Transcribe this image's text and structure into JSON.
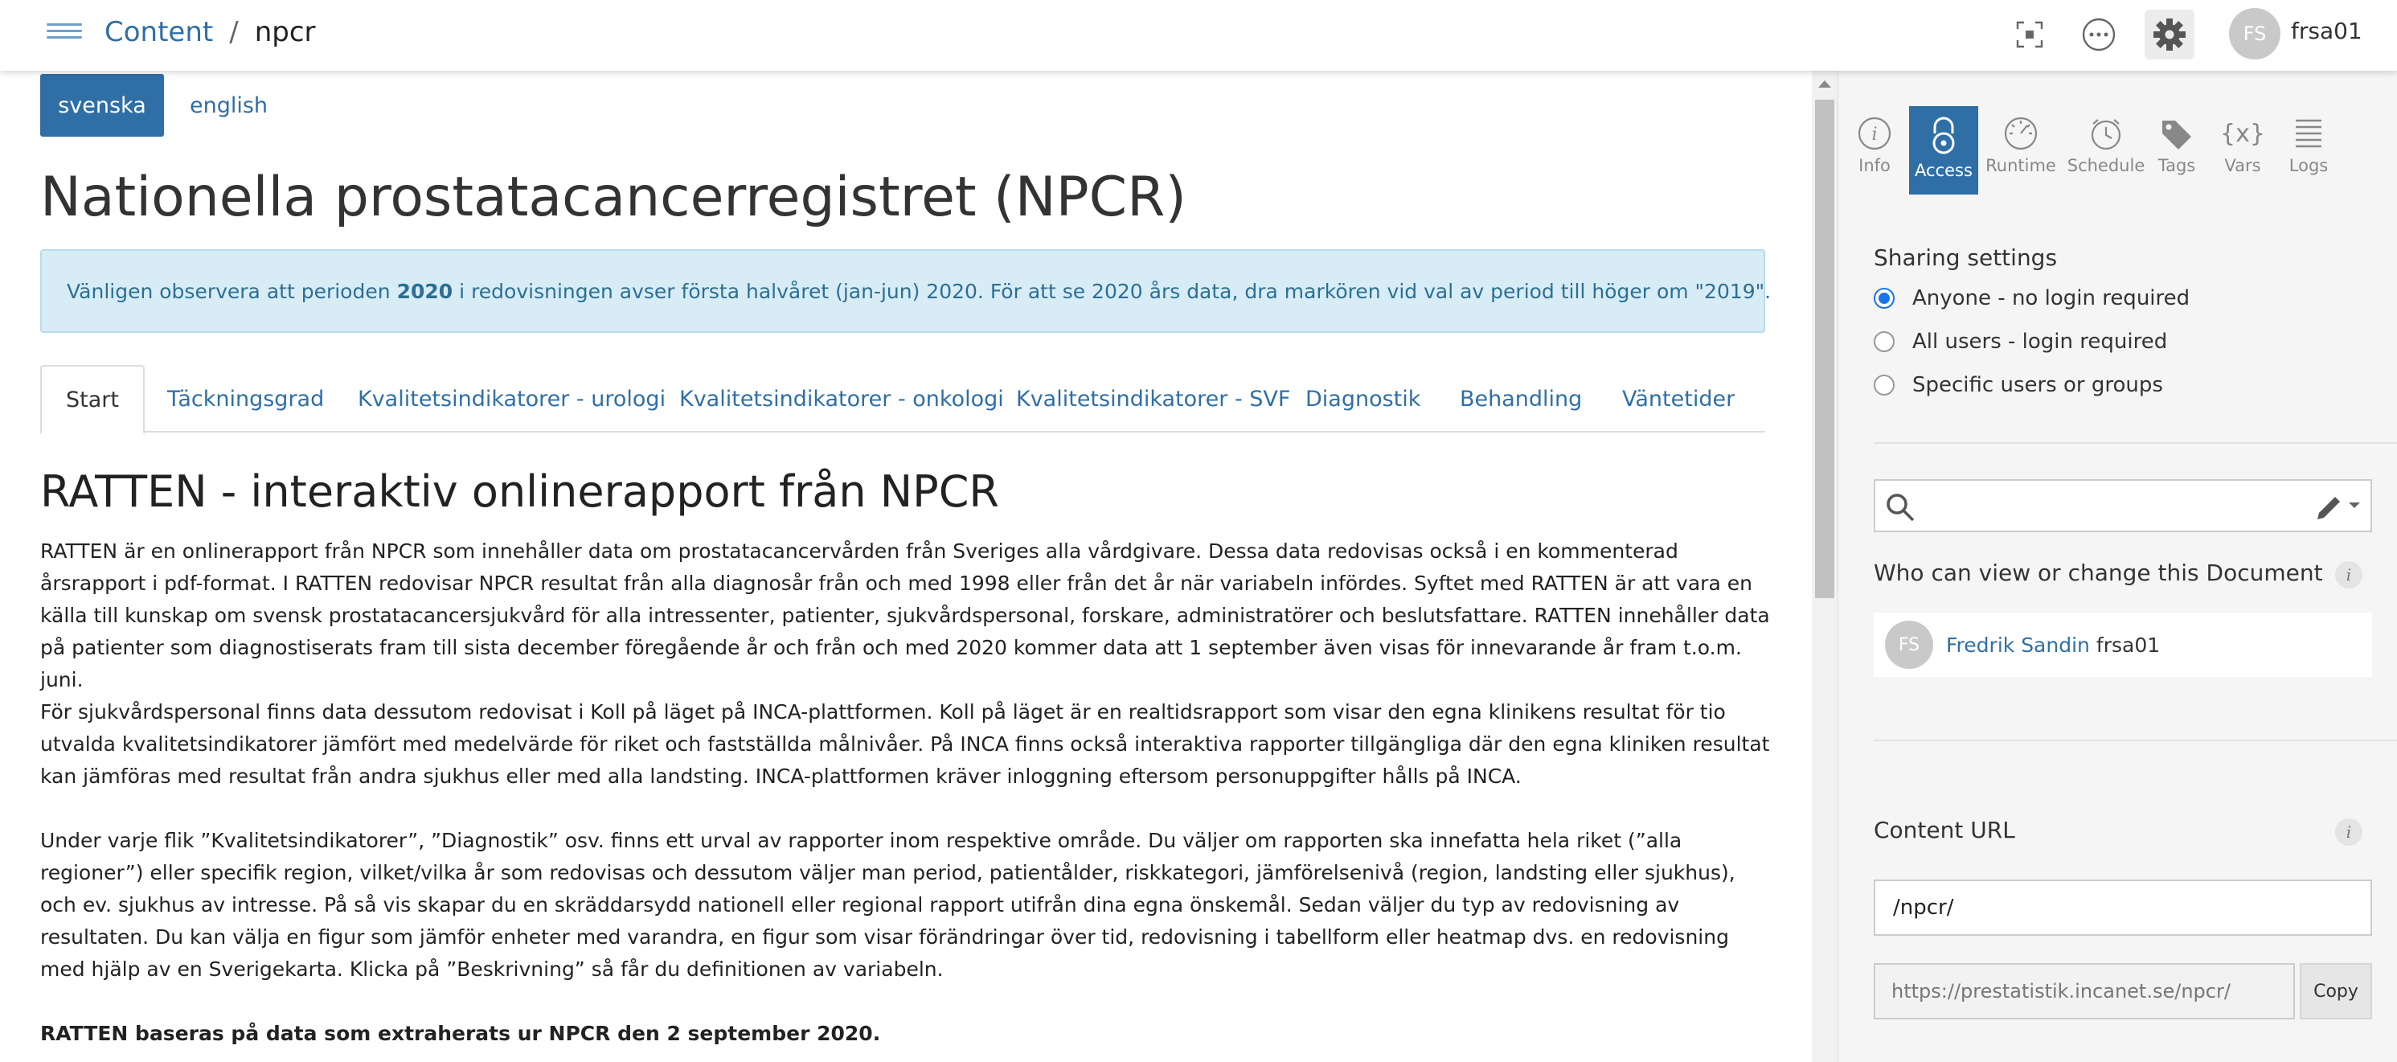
{
  "header": {
    "breadcrumb_root": "Content",
    "breadcrumb_sep": "/",
    "breadcrumb_current": "npcr",
    "avatar_initials": "FS",
    "username": "frsa01",
    "icons": [
      "menu-icon",
      "fullscreen-icon",
      "more-icon",
      "gear-icon"
    ]
  },
  "main": {
    "lang_active": "svenska",
    "lang_other": "english",
    "title": "Nationella prostatacancerregistret (NPCR)",
    "notice": {
      "before": "Vänligen observera att perioden",
      "bold": "2020",
      "after": "i redovisningen avser första halvåret (jan-jun) 2020. För att se 2020 års data, dra markören vid val av period till höger om \"2019\"."
    },
    "tabs": [
      {
        "label": "Start"
      },
      {
        "label": "Täckningsgrad"
      },
      {
        "label": "Kvalitetsindikatorer - urologi"
      },
      {
        "label": "Kvalitetsindikatorer - onkologi"
      },
      {
        "label": "Kvalitetsindikatorer - SVF"
      },
      {
        "label": "Diagnostik"
      },
      {
        "label": "Behandling"
      },
      {
        "label": "Väntetider"
      }
    ],
    "section_title": "RATTEN - interaktiv onlinerapport från NPCR",
    "paragraphs": [
      "RATTEN är en onlinerapport från NPCR som innehåller data om prostatacancervården från Sveriges alla vårdgivare. Dessa data redovisas också i en kommenterad årsrapport i pdf-format. I RATTEN redovisar NPCR resultat från alla diagnosår från och med 1998 eller från det år när variabeln infördes. Syftet med RATTEN är att vara en källa till kunskap om svensk prostatacancersjukvård för alla intressenter, patienter, sjukvårdspersonal, forskare, administratörer och beslutsfattare. RATTEN innehåller data på patienter som diagnostiserats fram till sista december föregående år och från och med 2020 kommer data att 1 september även visas för innevarande år fram t.o.m. juni.",
      "För sjukvårdspersonal finns data dessutom redovisat i Koll på läget på INCA-plattformen. Koll på läget är en realtidsrapport som visar den egna klinikens resultat för tio utvalda kvalitetsindikatorer jämfört med medelvärde för riket och fastställda målnivåer. På INCA finns också interaktiva rapporter tillgängliga där den egna kliniken resultat kan jämföras med resultat från andra sjukhus eller med alla landsting. INCA-plattformen kräver inloggning eftersom personuppgifter hålls på INCA.",
      "Under varje flik ”Kvalitetsindikatorer”, ”Diagnostik” osv. finns ett urval av rapporter inom respektive område. Du väljer om rapporten ska innefatta hela riket (”alla regioner”) eller specifik region, vilket/vilka år som redovisas och dessutom väljer man period, patientålder, riskkategori, jämförelsenivå (region, landsting eller sjukhus), och ev. sjukhus av intresse. På så vis skapar du en skräddarsydd nationell eller regional rapport utifrån dina egna önskemål. Sedan väljer du typ av redovisning av resultaten. Du kan välja en figur som jämför enheter med varandra, en figur som visar förändringar över tid, redovisning i tabellform eller heatmap dvs. en redovisning med hjälp av en Sverigekarta. Klicka på ”Beskrivning” så får du definitionen av variabeln.",
      "RATTEN baseras på data som extraherats ur NPCR den 2 september 2020."
    ]
  },
  "panel": {
    "tabs": [
      {
        "label": "Info",
        "icon": "info-icon"
      },
      {
        "label": "Access",
        "icon": "lock-icon"
      },
      {
        "label": "Runtime",
        "icon": "gauge-icon"
      },
      {
        "label": "Schedule",
        "icon": "clock-icon"
      },
      {
        "label": "Tags",
        "icon": "tag-icon"
      },
      {
        "label": "Vars",
        "icon": "braces-icon"
      },
      {
        "label": "Logs",
        "icon": "list-icon"
      }
    ],
    "active_tab": "Access",
    "sharing_title": "Sharing settings",
    "sharing_options": [
      {
        "label": "Anyone - no login required",
        "checked": true
      },
      {
        "label": "All users - login required",
        "checked": false
      },
      {
        "label": "Specific users or groups",
        "checked": false
      }
    ],
    "search_value": "",
    "who_title": "Who can view or change this Document",
    "info_glyph": "i",
    "user": {
      "initials": "FS",
      "name": "Fredrik Sandin",
      "id": "frsa01"
    },
    "url_title": "Content URL",
    "url_value": "/npcr/",
    "full_url": "https://prestatistik.incanet.se/npcr/",
    "copy_label": "Copy"
  },
  "colors": {
    "accent": "#2f6fa6",
    "notice_bg": "#d8ecf6",
    "radio_checked": "#1a73e8"
  }
}
